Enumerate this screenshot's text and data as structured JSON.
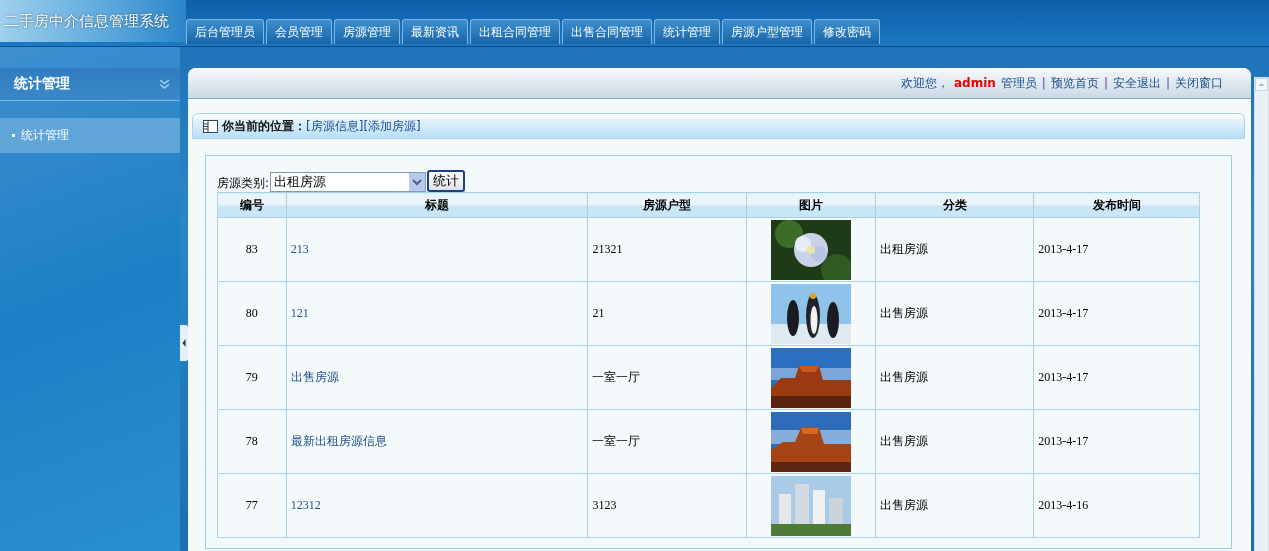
{
  "app_title": "二手房中介信息管理系统",
  "tabs": [
    {
      "label": "后台管理员",
      "selected": false
    },
    {
      "label": "会员管理",
      "selected": false
    },
    {
      "label": "房源管理",
      "selected": false
    },
    {
      "label": "最新资讯",
      "selected": false
    },
    {
      "label": "出租合同管理",
      "selected": false
    },
    {
      "label": "出售合同管理",
      "selected": false
    },
    {
      "label": "统计管理",
      "selected": false
    },
    {
      "label": "房源户型管理",
      "selected": false
    },
    {
      "label": "修改密码",
      "selected": false
    }
  ],
  "sidebar": {
    "title": "统计管理",
    "items": [
      {
        "label": "统计管理",
        "selected": true
      }
    ]
  },
  "header": {
    "welcome": "欢迎您，",
    "user": "admin",
    "role": "管理员",
    "items": [
      {
        "kind": "separator",
        "text": "|"
      },
      {
        "kind": "link",
        "text": "预览首页"
      },
      {
        "kind": "separator",
        "text": "|"
      },
      {
        "kind": "link",
        "text": "安全退出"
      },
      {
        "kind": "separator",
        "text": "|"
      },
      {
        "kind": "link",
        "text": "关闭窗口"
      }
    ]
  },
  "breadcrumb": {
    "label": "你当前的位置：",
    "links": [
      "[房源信息]",
      "[添加房源]"
    ]
  },
  "filter": {
    "label": "房源类别:",
    "value": "出租房源",
    "button": "统计"
  },
  "table": {
    "columns": [
      "编号",
      "标题",
      "房源户型",
      "图片",
      "分类",
      "发布时间"
    ],
    "rows": [
      {
        "id": "83",
        "title": "213",
        "layout": "21321",
        "category": "出租房源",
        "date": "2013-4-17"
      },
      {
        "id": "80",
        "title": "121",
        "layout": "21",
        "category": "出售房源",
        "date": "2013-4-17"
      },
      {
        "id": "79",
        "title": "出售房源",
        "layout": "一室一厅",
        "category": "出售房源",
        "date": "2013-4-17"
      },
      {
        "id": "78",
        "title": "最新出租房源信息",
        "layout": "一室一厅",
        "category": "出售房源",
        "date": "2013-4-17"
      },
      {
        "id": "77",
        "title": "12312",
        "layout": "3123",
        "category": "出售房源",
        "date": "2013-4-16"
      }
    ]
  }
}
